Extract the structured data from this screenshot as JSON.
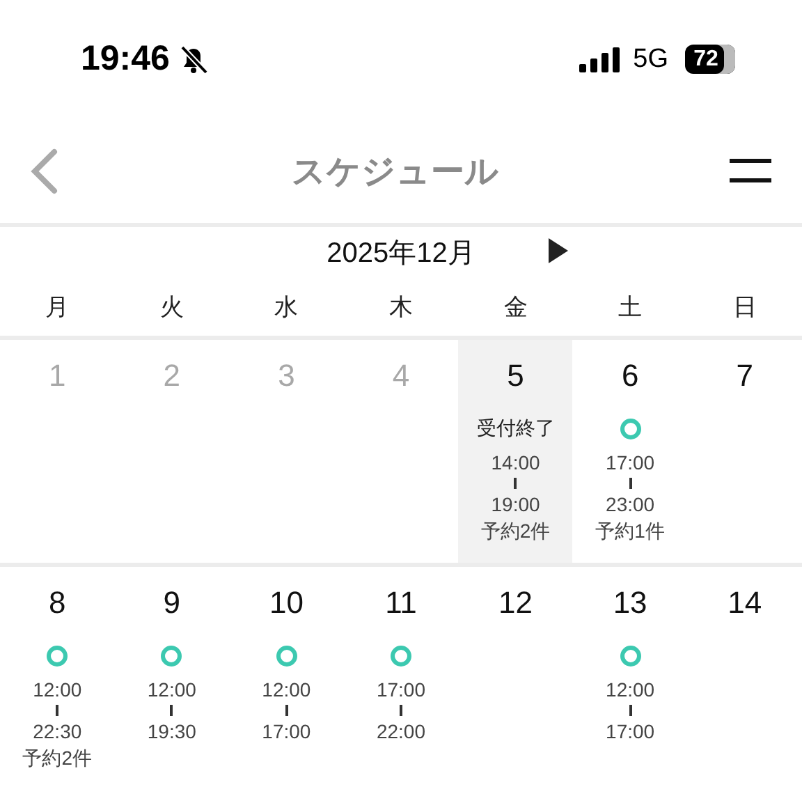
{
  "status_bar": {
    "time": "19:46",
    "network": "5G",
    "battery": "72"
  },
  "header": {
    "title": "スケジュール"
  },
  "calendar": {
    "month": "2025年12月",
    "weekdays": [
      "月",
      "火",
      "水",
      "木",
      "金",
      "土",
      "日"
    ],
    "weeks": [
      [
        {
          "day": "1",
          "past": true,
          "selected": false
        },
        {
          "day": "2",
          "past": true,
          "selected": false
        },
        {
          "day": "3",
          "past": true,
          "selected": false
        },
        {
          "day": "4",
          "past": true,
          "selected": false
        },
        {
          "day": "5",
          "past": false,
          "selected": true,
          "availability": {
            "kind": "closed",
            "label": "受付終了"
          },
          "start": "14:00",
          "end": "19:00",
          "bookings": "予約2件"
        },
        {
          "day": "6",
          "past": false,
          "selected": false,
          "availability": {
            "kind": "open"
          },
          "start": "17:00",
          "end": "23:00",
          "bookings": "予約1件"
        },
        {
          "day": "7",
          "past": false,
          "selected": false
        }
      ],
      [
        {
          "day": "8",
          "past": false,
          "selected": false,
          "availability": {
            "kind": "open"
          },
          "start": "12:00",
          "end": "22:30",
          "bookings": "予約2件"
        },
        {
          "day": "9",
          "past": false,
          "selected": false,
          "availability": {
            "kind": "open"
          },
          "start": "12:00",
          "end": "19:30"
        },
        {
          "day": "10",
          "past": false,
          "selected": false,
          "availability": {
            "kind": "open"
          },
          "start": "12:00",
          "end": "17:00"
        },
        {
          "day": "11",
          "past": false,
          "selected": false,
          "availability": {
            "kind": "open"
          },
          "start": "17:00",
          "end": "22:00"
        },
        {
          "day": "12",
          "past": false,
          "selected": false
        },
        {
          "day": "13",
          "past": false,
          "selected": false,
          "availability": {
            "kind": "open"
          },
          "start": "12:00",
          "end": "17:00"
        },
        {
          "day": "14",
          "past": false,
          "selected": false
        }
      ]
    ]
  }
}
